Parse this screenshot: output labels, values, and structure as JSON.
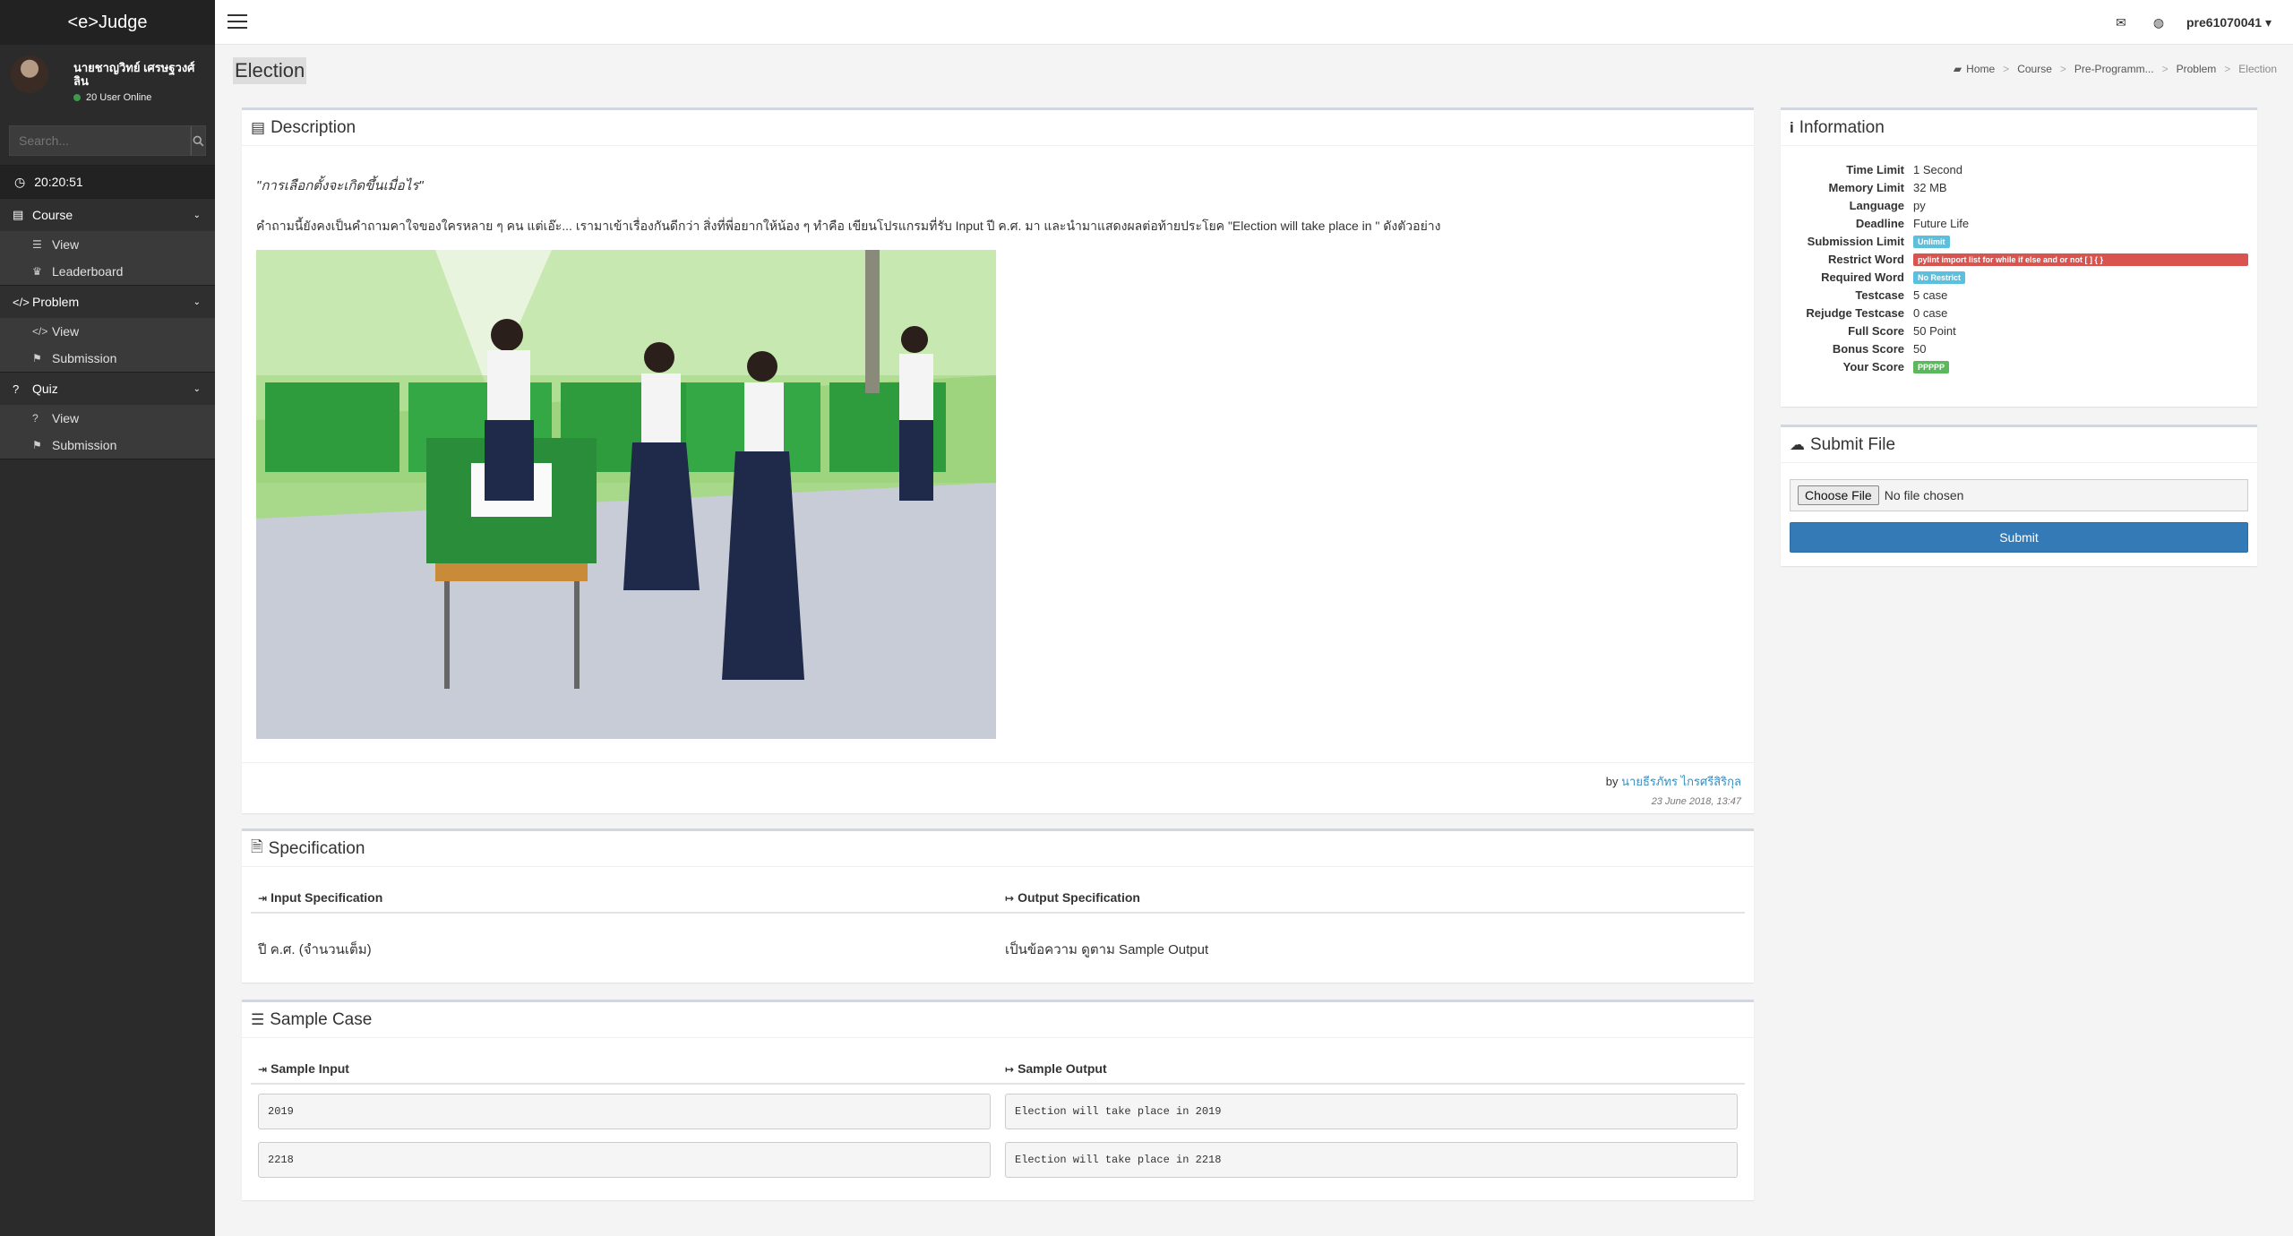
{
  "app": {
    "logo": "<e>Judge"
  },
  "user": {
    "name_line1": "นายชาญวิทย์ เศรษฐวงศ์",
    "name_line2": "ลิน",
    "online": "20 User Online"
  },
  "search": {
    "placeholder": "Search..."
  },
  "clock": "20:20:51",
  "sidebar": {
    "course": {
      "label": "Course",
      "items": [
        {
          "label": "View"
        },
        {
          "label": "Leaderboard"
        }
      ]
    },
    "problem": {
      "label": "Problem",
      "items": [
        {
          "label": "View"
        },
        {
          "label": "Submission"
        }
      ]
    },
    "quiz": {
      "label": "Quiz",
      "items": [
        {
          "label": "View"
        },
        {
          "label": "Submission"
        }
      ]
    }
  },
  "topbar": {
    "username": "pre61070041"
  },
  "page": {
    "title": "Election"
  },
  "breadcrumb": [
    "Home",
    "Course",
    "Pre-Programm...",
    "Problem",
    "Election"
  ],
  "description": {
    "title": "Description",
    "quote": "\"การเลือกตั้งจะเกิดขึ้นเมื่อไร\"",
    "text": "คำถามนี้ยังคงเป็นคำถามคาใจของใครหลาย ๆ คน แต่เอ๊ะ... เรามาเข้าเรื่องกันดีกว่า สิ่งที่พี่อยากให้น้อง ๆ ทำคือ เขียนโปรแกรมที่รับ Input ปี ค.ศ. มา และนำมาแสดงผลต่อท้ายประโยค \"Election will take place in \" ดังตัวอย่าง",
    "by_prefix": "by",
    "author": "นายธีรภัทร ไกรศรีสิริกุล",
    "date": "23 June 2018, 13:47"
  },
  "specification": {
    "title": "Specification",
    "input_head": "Input Specification",
    "output_head": "Output Specification",
    "input_value": "ปี ค.ศ. (จำนวนเต็ม)",
    "output_value": "เป็นข้อความ ดูตาม Sample Output"
  },
  "sample": {
    "title": "Sample Case",
    "input_head": "Sample Input",
    "output_head": "Sample Output",
    "cases": [
      {
        "input": "2019",
        "output": "Election will take place in 2019"
      },
      {
        "input": "2218",
        "output": "Election will take place in 2218"
      }
    ]
  },
  "information": {
    "title": "Information",
    "rows": [
      {
        "key": "Time Limit",
        "value": "1 Second"
      },
      {
        "key": "Memory Limit",
        "value": "32 MB"
      },
      {
        "key": "Language",
        "value": "py"
      },
      {
        "key": "Deadline",
        "value": "Future Life"
      },
      {
        "key": "Submission Limit",
        "value": "Unlimit"
      },
      {
        "key": "Restrict Word",
        "value": "pylint import list for while if else and or not [ ] { }"
      },
      {
        "key": "Required Word",
        "value": "No Restrict"
      },
      {
        "key": "Testcase",
        "value": "5 case"
      },
      {
        "key": "Rejudge Testcase",
        "value": "0 case"
      },
      {
        "key": "Full Score",
        "value": "50 Point"
      },
      {
        "key": "Bonus Score",
        "value": "50"
      },
      {
        "key": "Your Score",
        "value": "PPPPP"
      }
    ]
  },
  "submit": {
    "title": "Submit File",
    "choose_label": "Choose File",
    "no_file": "No file chosen",
    "button": "Submit"
  },
  "colors": {
    "sidebar": "#2b2b2b",
    "primary": "#337ab7",
    "label_blue": "#5bc0de",
    "label_red": "#d9534f",
    "label_green": "#5cb85c"
  }
}
